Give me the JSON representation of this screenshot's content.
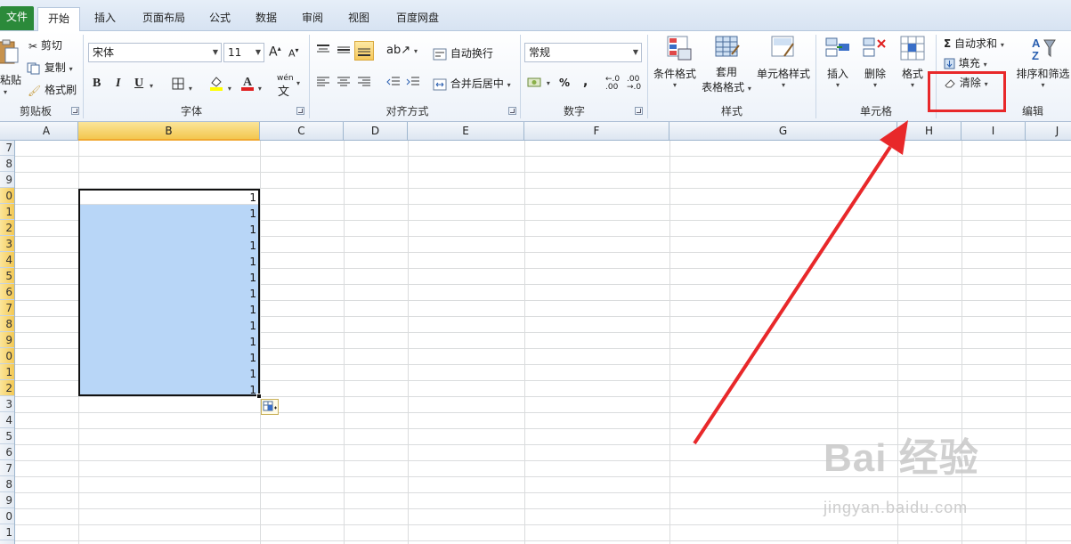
{
  "tabs": {
    "file": "文件",
    "items": [
      "开始",
      "插入",
      "页面布局",
      "公式",
      "数据",
      "审阅",
      "视图",
      "百度网盘"
    ],
    "active": "开始"
  },
  "clipboard": {
    "paste": "粘贴",
    "cut": "剪切",
    "copy": "复制",
    "format_painter": "格式刷",
    "label": "剪贴板"
  },
  "font": {
    "name": "宋体",
    "size": "11",
    "bold": "B",
    "italic": "I",
    "underline": "U",
    "wen": "wén",
    "label": "字体"
  },
  "alignment": {
    "wrap_text": "自动换行",
    "merge_center": "合并后居中",
    "label": "对齐方式"
  },
  "number": {
    "format": "常规",
    "percent": "%",
    "comma": ",",
    "label": "数字"
  },
  "styles": {
    "conditional": "条件格式",
    "table_line1": "套用",
    "table_line2": "表格格式",
    "cell_styles": "单元格样式",
    "label": "样式"
  },
  "cells": {
    "insert": "插入",
    "delete": "删除",
    "format": "格式",
    "label": "单元格"
  },
  "editing": {
    "sigma": "Σ",
    "autosum": "自动求和",
    "fill": "填充",
    "clear": "清除",
    "sort_filter": "排序和筛选",
    "label": "编辑"
  },
  "columns": [
    "A",
    "B",
    "C",
    "D",
    "E",
    "F",
    "G",
    "H",
    "I",
    "J"
  ],
  "selected_column": "B",
  "row_labels": [
    "7",
    "8",
    "9",
    "0",
    "1",
    "2",
    "3",
    "4",
    "5",
    "6",
    "7",
    "8",
    "9",
    "0",
    "1",
    "2",
    "3",
    "4",
    "5",
    "6",
    "7",
    "8",
    "9",
    "0",
    "1"
  ],
  "cell_values": [
    "1",
    "1",
    "1",
    "1",
    "1",
    "1",
    "1",
    "1",
    "1",
    "1",
    "1",
    "1",
    "1"
  ],
  "watermark": {
    "brand": "Bai 经验",
    "url": "jingyan.baidu.com"
  },
  "colors": {
    "file_tab": "#2b8a3a",
    "selection_fill": "#b8d6f7",
    "annotation_red": "#e8282a",
    "header_highlight": "#f3c74f"
  }
}
